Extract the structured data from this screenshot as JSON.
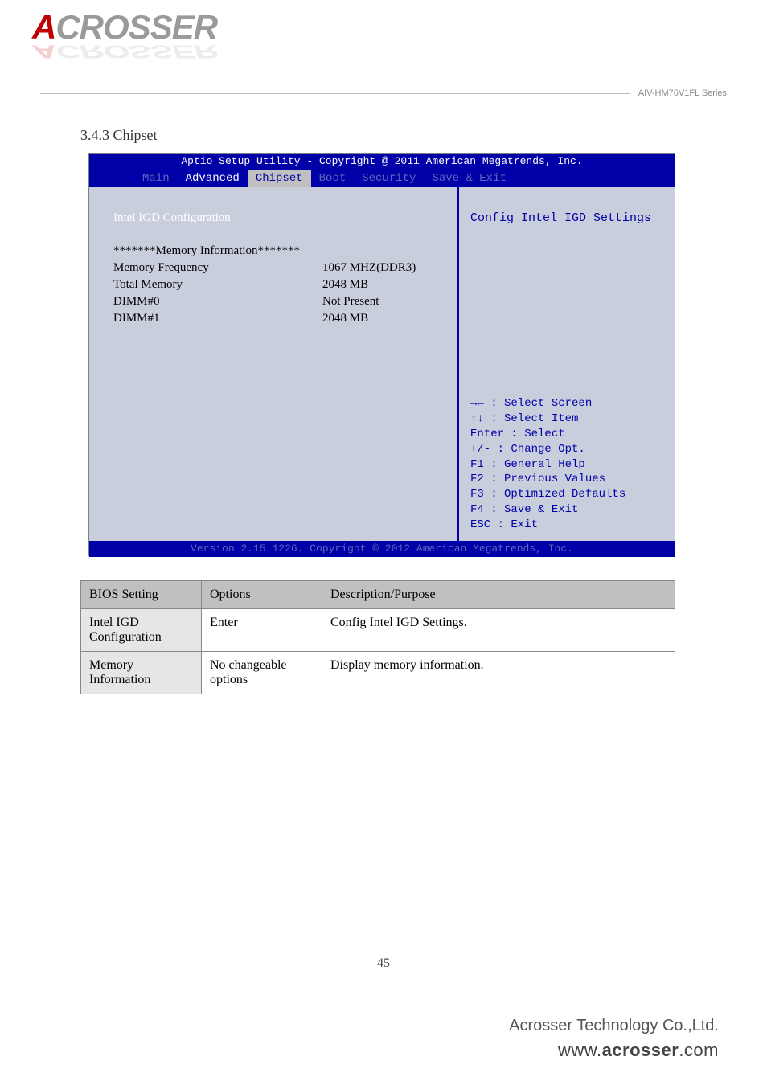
{
  "logo": {
    "text_prefix": "A",
    "text_rest": "CROSSER"
  },
  "doc_title": "AIV-HM76V1FL Series",
  "section_heading": "3.4.3 Chipset",
  "bios": {
    "top_bar": "Aptio Setup Utility - Copyright @ 2011 American Megatrends, Inc.",
    "tabs": {
      "main": "Main",
      "advanced": "Advanced",
      "chipset": "Chipset",
      "boot": "Boot",
      "security": "Security",
      "save_exit": "Save & Exit"
    },
    "main_panel": {
      "link_item": "Intel IGD Configuration",
      "mem_header": "*******Memory Information*******",
      "rows": [
        {
          "label": "Memory Frequency",
          "value": "1067 MHZ(DDR3)"
        },
        {
          "label": "Total Memory",
          "value": "2048 MB"
        },
        {
          "label": "DIMM#0",
          "value": "Not Present"
        },
        {
          "label": "DIMM#1",
          "value": "2048 MB"
        }
      ]
    },
    "side_panel": {
      "help_text": "Config Intel IGD Settings",
      "keys": [
        "→← : Select Screen",
        "↑↓ : Select Item",
        "Enter : Select",
        "+/- : Change Opt.",
        "F1 : General Help",
        "F2 : Previous Values",
        "F3 : Optimized Defaults",
        "F4 : Save & Exit",
        "ESC : Exit"
      ]
    },
    "footer": "Version 2.15.1226. Copyright © 2012 American Megatrends, Inc."
  },
  "desc_table": {
    "headers": {
      "a": "BIOS Setting",
      "b": "Options",
      "c": "Description/Purpose"
    },
    "rows": [
      {
        "a": "Intel IGD Configuration",
        "b": "Enter",
        "c": "Config Intel IGD Settings."
      },
      {
        "a": "Memory Information",
        "b": "No changeable options",
        "c": "Display memory information."
      }
    ]
  },
  "page_number": "45",
  "footer": {
    "company": "Acrosser Technology Co.,Ltd.",
    "url_prefix": "www.",
    "url_bold": "acrosser",
    "url_suffix": ".com"
  }
}
